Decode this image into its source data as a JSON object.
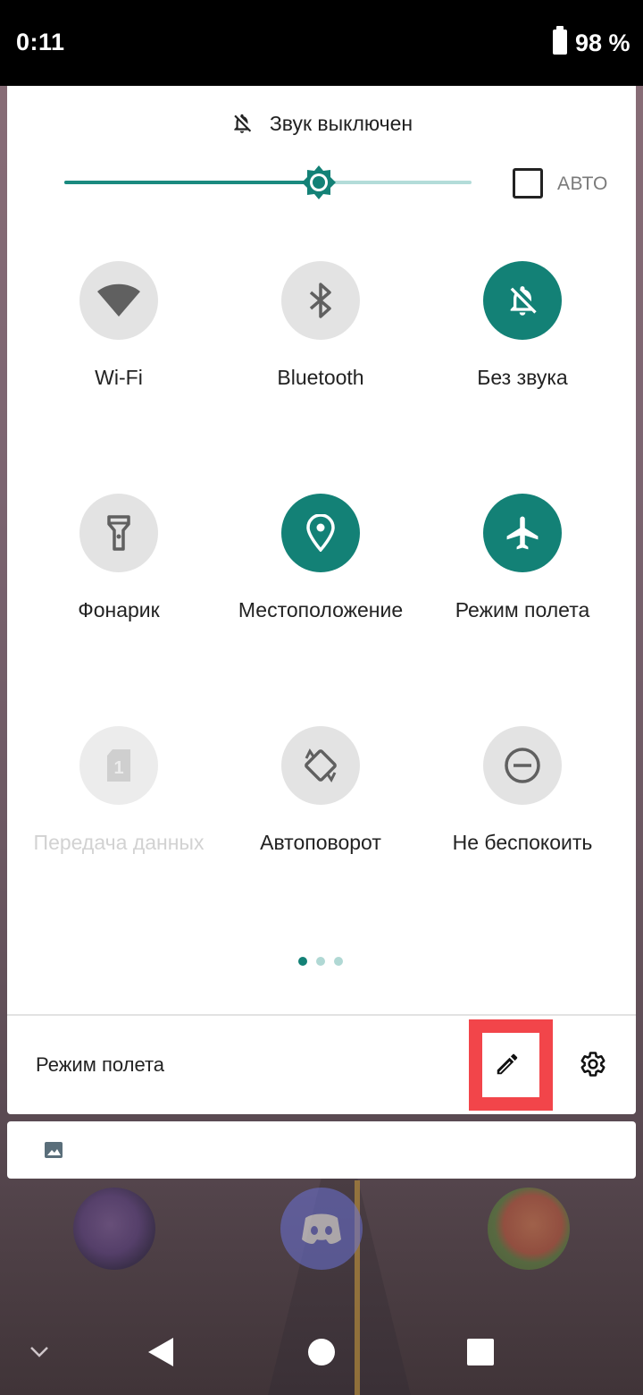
{
  "status_bar": {
    "time": "0:11",
    "battery": "98 %"
  },
  "header": {
    "sound_status": "Звук выключен",
    "icon": "bell-off-icon"
  },
  "brightness": {
    "level_fraction": 0.625,
    "auto_label": "АВТО",
    "auto_checked": false
  },
  "tiles": [
    {
      "label": "Wi-Fi",
      "icon": "wifi-icon",
      "state": "off"
    },
    {
      "label": "Bluetooth",
      "icon": "bluetooth-icon",
      "state": "off"
    },
    {
      "label": "Без звука",
      "icon": "bell-off-icon",
      "state": "on"
    },
    {
      "label": "Фонарик",
      "icon": "flashlight-icon",
      "state": "off"
    },
    {
      "label": "Местоположение",
      "icon": "location-pin-icon",
      "state": "on"
    },
    {
      "label": "Режим полета",
      "icon": "airplane-icon",
      "state": "on"
    },
    {
      "label": "Передача данных",
      "icon": "sim-card-icon",
      "state": "disabled"
    },
    {
      "label": "Автоповорот",
      "icon": "auto-rotate-icon",
      "state": "off"
    },
    {
      "label": "Не беспокоить",
      "icon": "do-not-disturb-icon",
      "state": "off"
    }
  ],
  "pagination": {
    "current": 1,
    "total": 3
  },
  "footer": {
    "label": "Режим полета",
    "edit_icon": "pencil-icon",
    "settings_icon": "gear-icon"
  },
  "notification": {
    "icon": "image-icon"
  },
  "colors": {
    "accent": "#138176",
    "highlight": "#f2454a"
  }
}
